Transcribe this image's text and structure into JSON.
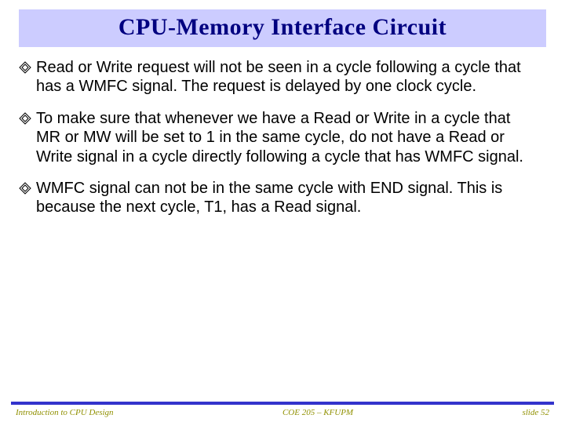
{
  "title": "CPU-Memory Interface Circuit",
  "bullets": [
    "Read or Write request will not be seen in a cycle following a cycle that has a WMFC signal. The request is delayed by one clock cycle.",
    "To make sure that whenever we have a Read or Write in a cycle that MR or MW will be set to 1 in the same cycle, do not have a Read or Write signal in a cycle directly following a cycle that has WMFC signal.",
    "WMFC signal can not be in the same cycle with END signal. This is because the next cycle, T1, has a Read signal."
  ],
  "footer": {
    "left": "Introduction to CPU Design",
    "center": "COE 205 – KFUPM",
    "right": "slide 52"
  }
}
